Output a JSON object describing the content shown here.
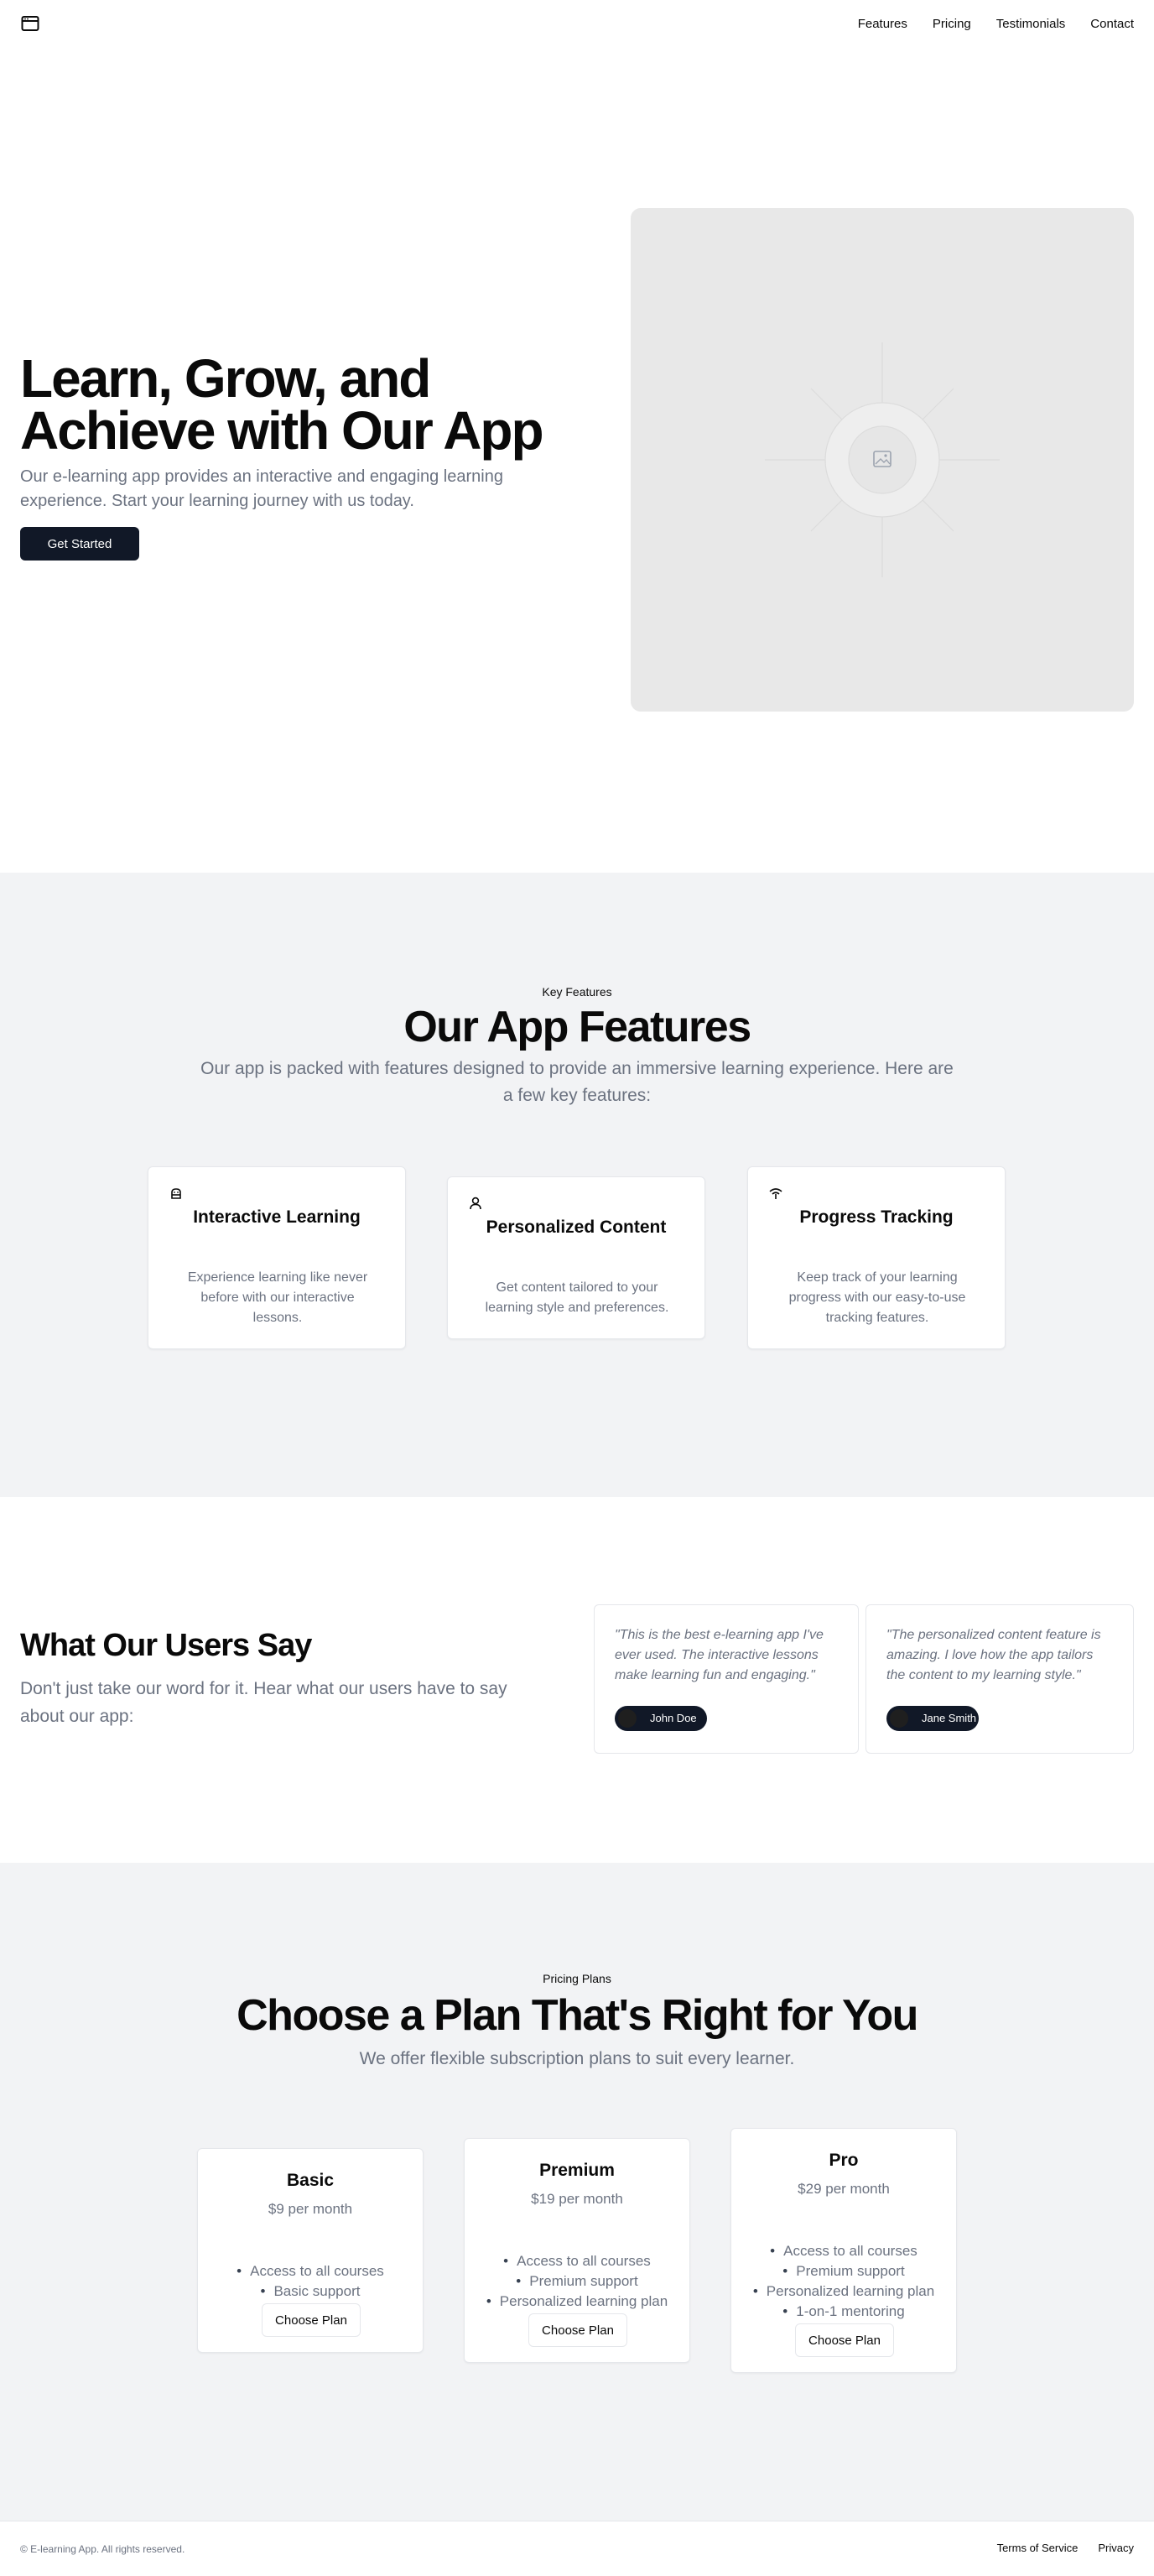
{
  "header": {
    "logo_icon": "app-window-icon",
    "nav": [
      "Features",
      "Pricing",
      "Testimonials",
      "Contact"
    ]
  },
  "hero": {
    "title": "Learn, Grow, and Achieve with Our App",
    "description": "Our e-learning app provides an interactive and engaging learning experience. Start your learning journey with us today.",
    "cta_label": "Get Started",
    "image_icon": "image-placeholder-icon"
  },
  "features": {
    "eyebrow": "Key Features",
    "title": "Our App Features",
    "description": "Our app is packed with features designed to provide an immersive learning experience. Here are a few key features:",
    "cards": [
      {
        "icon": "lab-icon",
        "title": "Interactive Learning",
        "text": "Experience learning like never before with our interactive lessons."
      },
      {
        "icon": "user-icon",
        "title": "Personalized Content",
        "text": "Get content tailored to your learning style and preferences."
      },
      {
        "icon": "signal-icon",
        "title": "Progress Tracking",
        "text": "Keep track of your learning progress with our easy-to-use tracking features."
      }
    ]
  },
  "testimonials": {
    "title": "What Our Users Say",
    "description": "Don't just take our word for it. Hear what our users have to say about our app:",
    "items": [
      {
        "quote": "\"This is the best e-learning app I've ever used. The interactive lessons make learning fun and engaging.\"",
        "author": "John Doe"
      },
      {
        "quote": "\"The personalized content feature is amazing. I love how the app tailors the content to my learning style.\"",
        "author": "Jane Smith"
      }
    ]
  },
  "pricing": {
    "eyebrow": "Pricing Plans",
    "title": "Choose a Plan That's Right for You",
    "description": "We offer flexible subscription plans to suit every learner.",
    "plans": [
      {
        "name": "Basic",
        "price": "$9 per month",
        "features": [
          "Access to all courses",
          "Basic support"
        ],
        "button": "Choose Plan"
      },
      {
        "name": "Premium",
        "price": "$19 per month",
        "features": [
          "Access to all courses",
          "Premium support",
          "Personalized learning plan"
        ],
        "button": "Choose Plan"
      },
      {
        "name": "Pro",
        "price": "$29 per month",
        "features": [
          "Access to all courses",
          "Premium support",
          "Personalized learning plan",
          "1-on-1 mentoring"
        ],
        "button": "Choose Plan"
      }
    ]
  },
  "footer": {
    "copyright": "© E-learning App. All rights reserved.",
    "links": [
      "Terms of Service",
      "Privacy"
    ]
  }
}
